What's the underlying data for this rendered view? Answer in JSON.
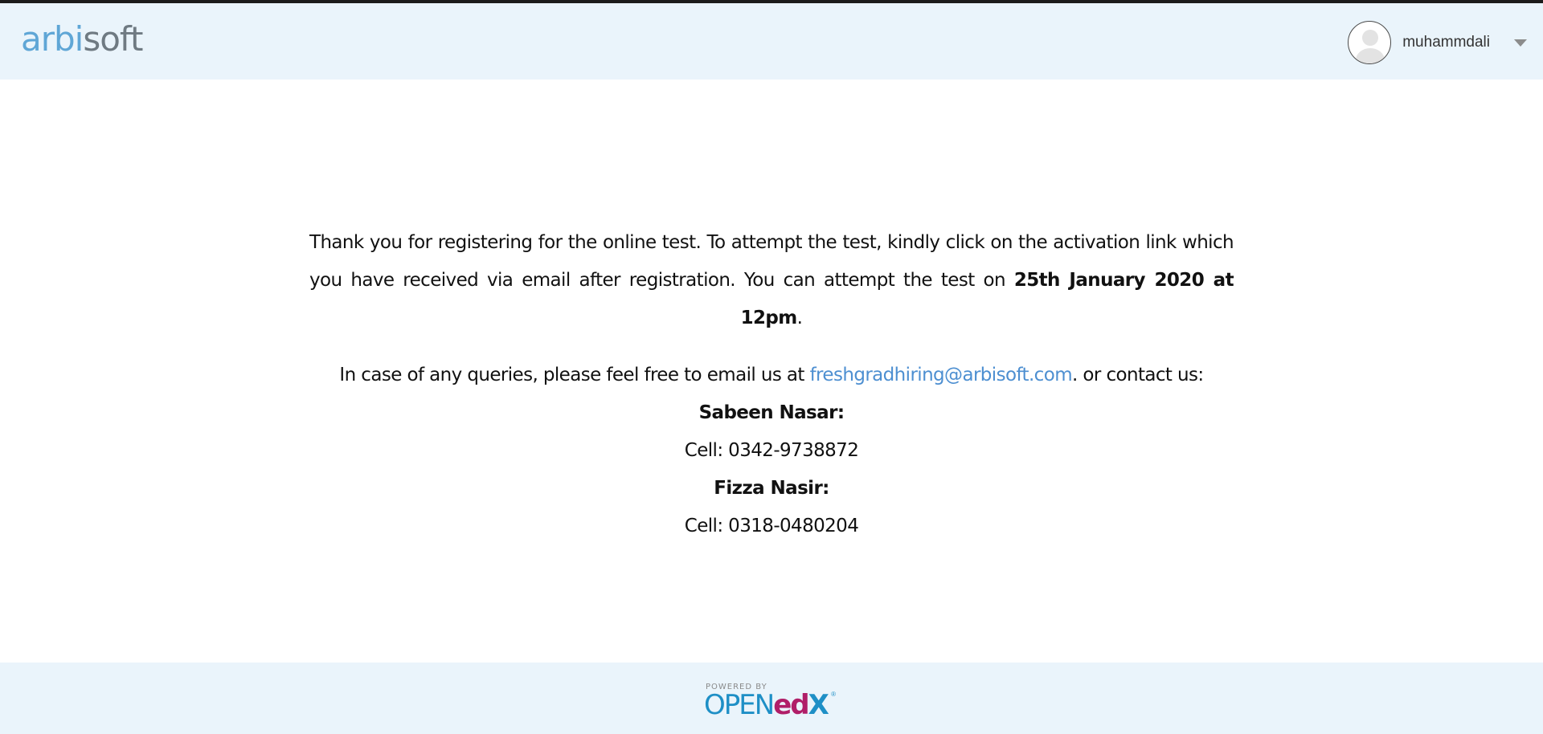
{
  "header": {
    "logo": {
      "part1": "arbi",
      "part2": "soft"
    },
    "username": "muhammdali"
  },
  "content": {
    "intro_text": "Thank you for registering for the online test. To attempt the test, kindly click on the activation link which you have received via email after registration. You can attempt the test on ",
    "test_date": "25th January 2020 at 12pm",
    "intro_end": ".",
    "query_text": "In case of any queries, please feel free to email us at ",
    "email": "freshgradhiring@arbisoft.com",
    "query_end": ". or contact us:",
    "contacts": [
      {
        "name": "Sabeen Nasar:",
        "cell": "Cell: 0342-9738872"
      },
      {
        "name": "Fizza Nasir:",
        "cell": "Cell: 0318-0480204"
      }
    ]
  },
  "footer": {
    "powered_by": "POWERED BY",
    "brand_open": "OPEN",
    "brand_ed": "ed",
    "brand_x": "X",
    "brand_reg": "®"
  },
  "colors": {
    "header_bg": "#eaf4fb",
    "logo_blue": "#5fa6d6",
    "logo_grey": "#6f7a82",
    "link": "#4d8fd1",
    "openedx_blue": "#1e8fc6",
    "openedx_magenta": "#b01e68"
  }
}
